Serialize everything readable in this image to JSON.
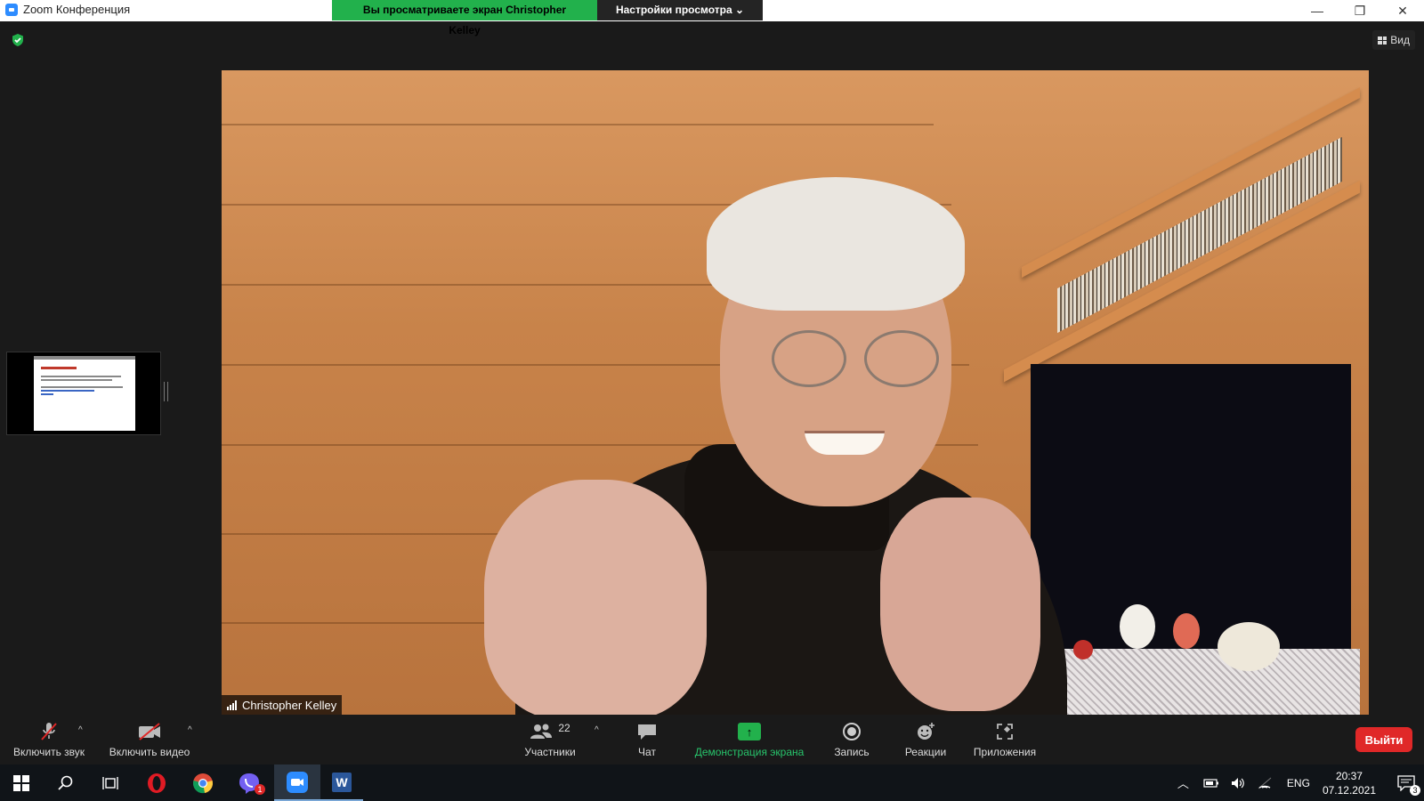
{
  "window": {
    "app_title": "Zoom Конференция",
    "share_banner": "Вы просматриваете экран Christopher Kelley",
    "view_settings": "Настройки просмотра ⌄",
    "controls": {
      "minimize": "—",
      "restore": "❐",
      "close": "✕"
    }
  },
  "top": {
    "view_label": "Вид"
  },
  "video": {
    "participant_name": "Christopher Kelley"
  },
  "toolbar": {
    "unmute": "Включить звук",
    "start_video": "Включить видео",
    "participants": "Участники",
    "participant_count": "22",
    "chat": "Чат",
    "share_screen": "Демонстрация экрана",
    "record": "Запись",
    "reactions": "Реакции",
    "apps": "Приложения",
    "leave": "Выйти",
    "caret": "^"
  },
  "taskbar": {
    "viber_badge": "1",
    "word_label": "W",
    "lang": "ENG",
    "time": "20:37",
    "date": "07.12.2021",
    "notifications": "3"
  },
  "colors": {
    "accent_green": "#22b14c",
    "leave_red": "#e02828",
    "zoom_blue": "#2d8cff"
  }
}
